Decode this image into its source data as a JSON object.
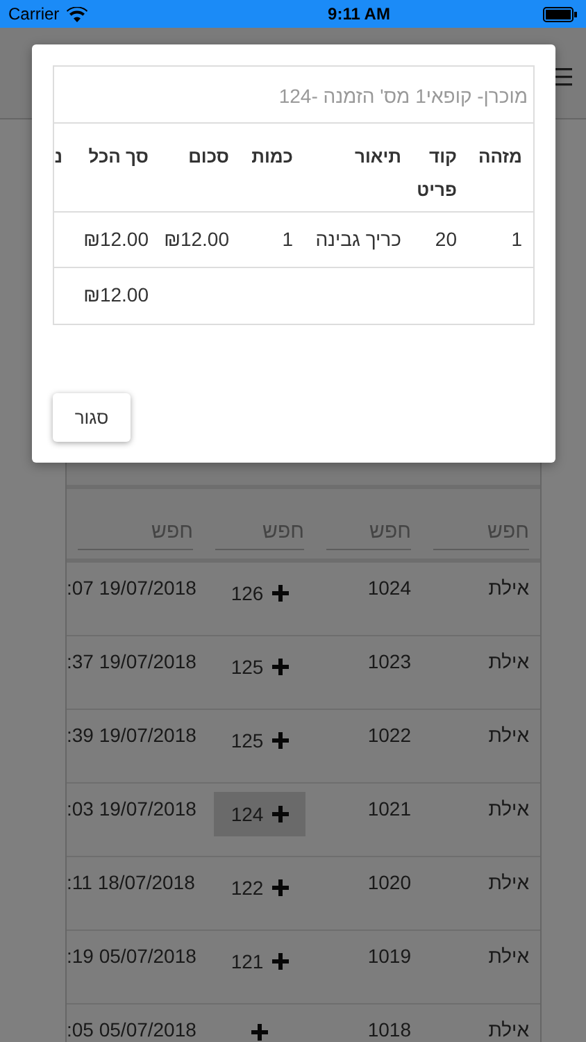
{
  "status_bar": {
    "carrier": "Carrier",
    "time": "9:11 AM"
  },
  "orders_table": {
    "search_placeholders": [
      "חפש",
      "חפש",
      "חפש",
      "חפש"
    ],
    "rows": [
      {
        "branch": "אילת",
        "id": "1024",
        "order": "126",
        "date": ":07 19/07/2018",
        "highlighted": false
      },
      {
        "branch": "אילת",
        "id": "1023",
        "order": "125",
        "date": ":37 19/07/2018",
        "highlighted": false
      },
      {
        "branch": "אילת",
        "id": "1022",
        "order": "125",
        "date": ":39 19/07/2018",
        "highlighted": false
      },
      {
        "branch": "אילת",
        "id": "1021",
        "order": "124",
        "date": ":03 19/07/2018",
        "highlighted": true
      },
      {
        "branch": "אילת",
        "id": "1020",
        "order": "122",
        "date": ":11 18/07/2018",
        "highlighted": false
      },
      {
        "branch": "אילת",
        "id": "1019",
        "order": "121",
        "date": ":19 05/07/2018",
        "highlighted": false
      },
      {
        "branch": "אילת",
        "id": "1018",
        "order": "",
        "date": ":05 05/07/2018",
        "highlighted": false
      }
    ]
  },
  "dialog": {
    "title": "מוכרן- קופאי1 מס' הזמנה -124",
    "columns": [
      "מזהה",
      "קוד פריט",
      "תיאור",
      "כמות",
      "סכום",
      "סך הכל",
      "נ"
    ],
    "rows": [
      {
        "cells": [
          "1",
          "20",
          "כריך גבינה",
          "1",
          "₪12.00",
          "₪12.00"
        ]
      }
    ],
    "total": "₪12.00",
    "close_button": "סגור"
  }
}
